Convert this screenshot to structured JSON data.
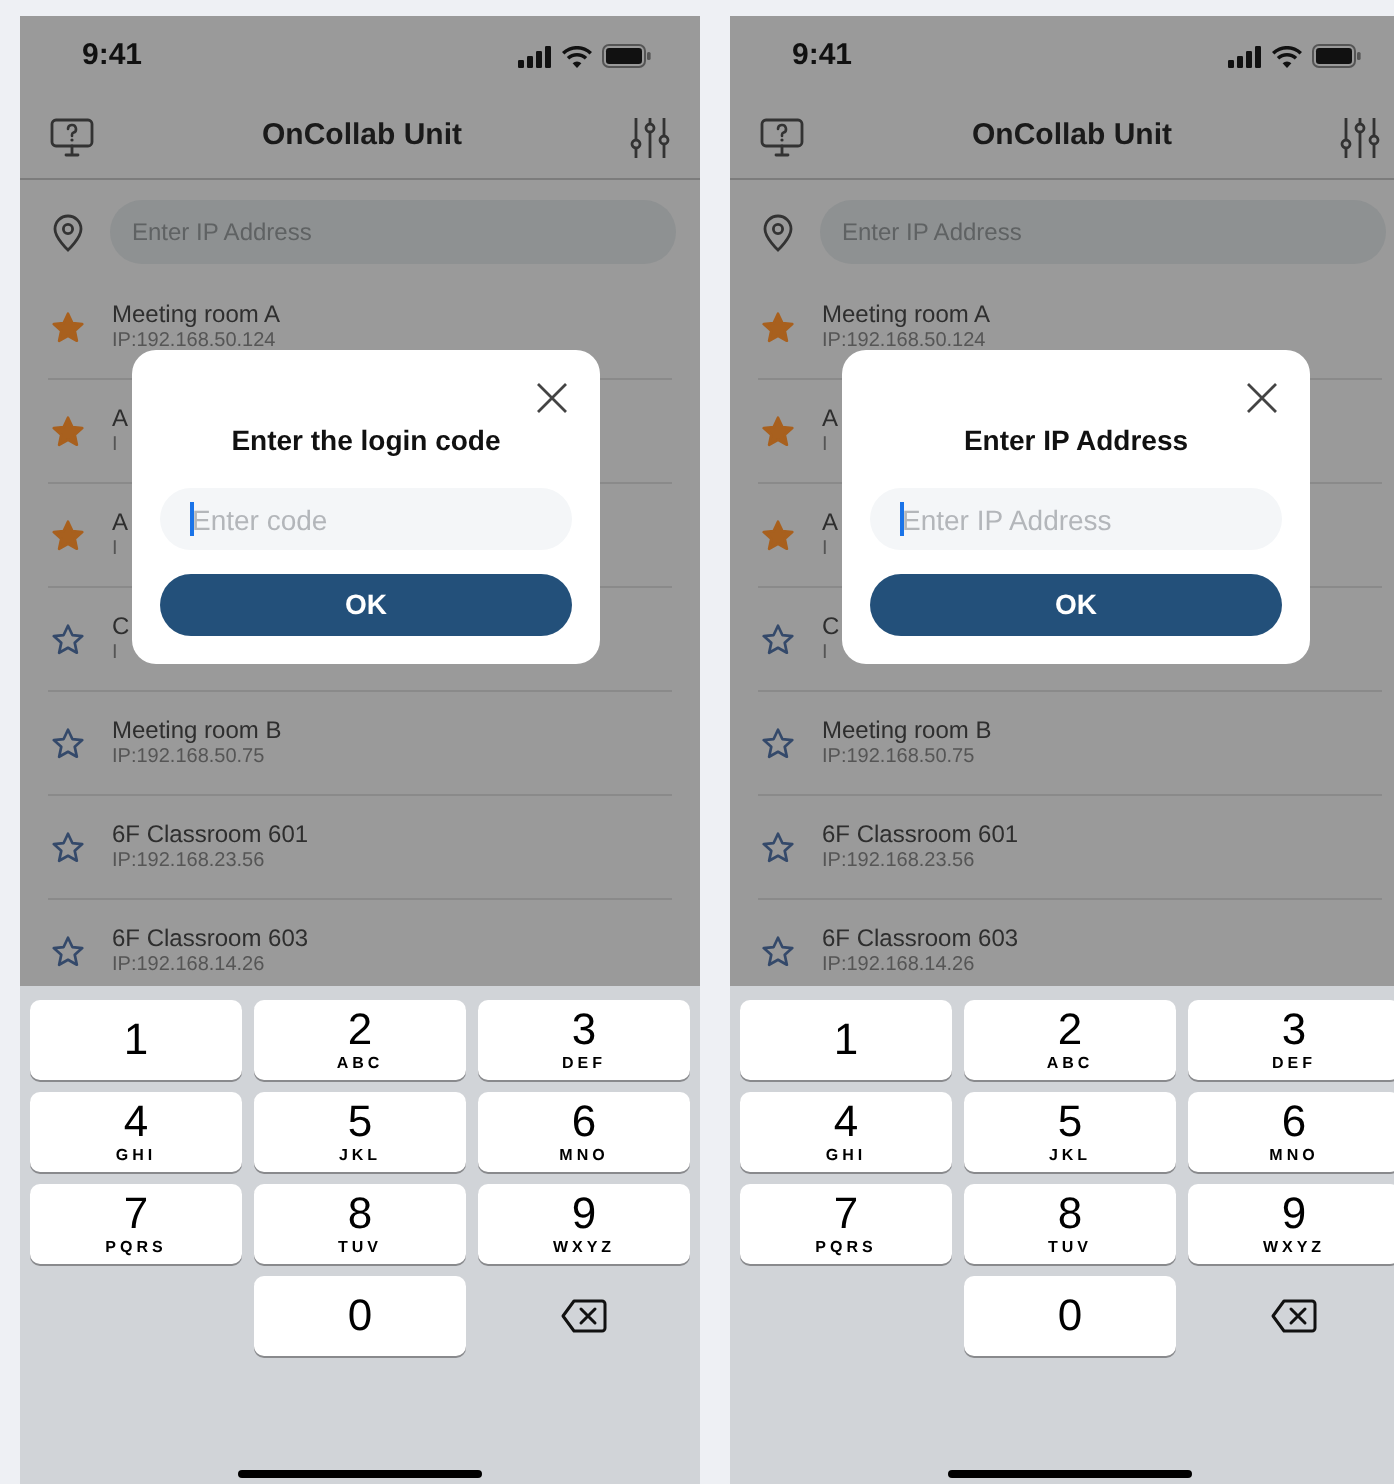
{
  "screens": [
    {
      "status_bar": {
        "time": "9:41"
      },
      "header": {
        "title": "OnCollab Unit"
      },
      "search": {
        "placeholder": "Enter IP Address"
      },
      "rooms": [
        {
          "name": "Meeting room A",
          "ip": "IP:192.168.50.124",
          "favorite": true
        },
        {
          "name": "A",
          "ip": "I",
          "favorite": true
        },
        {
          "name": "A",
          "ip": "I",
          "favorite": true
        },
        {
          "name": "C",
          "ip": "I",
          "favorite": false
        },
        {
          "name": "Meeting room B",
          "ip": "IP:192.168.50.75",
          "favorite": false
        },
        {
          "name": "6F Classroom 601",
          "ip": "IP:192.168.23.56",
          "favorite": false
        },
        {
          "name": "6F Classroom 603",
          "ip": "IP:192.168.14.26",
          "favorite": false
        }
      ],
      "dialog": {
        "title": "Enter the login code",
        "placeholder": "Enter code",
        "button": "OK"
      },
      "keypad": [
        {
          "kind": "digit",
          "digit": "1"
        },
        {
          "kind": "digit",
          "digit": "2",
          "letters": "ABC"
        },
        {
          "kind": "digit",
          "digit": "3",
          "letters": "DEF"
        },
        {
          "kind": "digit",
          "digit": "4",
          "letters": "GHI"
        },
        {
          "kind": "digit",
          "digit": "5",
          "letters": "JKL"
        },
        {
          "kind": "digit",
          "digit": "6",
          "letters": "MNO"
        },
        {
          "kind": "digit",
          "digit": "7",
          "letters": "PQRS"
        },
        {
          "kind": "digit",
          "digit": "8",
          "letters": "TUV"
        },
        {
          "kind": "digit",
          "digit": "9",
          "letters": "WXYZ"
        },
        {
          "kind": "blank"
        },
        {
          "kind": "digit",
          "digit": "0"
        },
        {
          "kind": "backspace"
        }
      ]
    },
    {
      "status_bar": {
        "time": "9:41"
      },
      "header": {
        "title": "OnCollab Unit"
      },
      "search": {
        "placeholder": "Enter IP Address"
      },
      "rooms": [
        {
          "name": "Meeting room A",
          "ip": "IP:192.168.50.124",
          "favorite": true
        },
        {
          "name": "A",
          "ip": "I",
          "favorite": true
        },
        {
          "name": "A",
          "ip": "I",
          "favorite": true
        },
        {
          "name": "C",
          "ip": "I",
          "favorite": false
        },
        {
          "name": "Meeting room B",
          "ip": "IP:192.168.50.75",
          "favorite": false
        },
        {
          "name": "6F Classroom 601",
          "ip": "IP:192.168.23.56",
          "favorite": false
        },
        {
          "name": "6F Classroom 603",
          "ip": "IP:192.168.14.26",
          "favorite": false
        }
      ],
      "dialog": {
        "title": "Enter IP Address",
        "placeholder": "Enter IP Address",
        "button": "OK"
      },
      "keypad": [
        {
          "kind": "digit",
          "digit": "1"
        },
        {
          "kind": "digit",
          "digit": "2",
          "letters": "ABC"
        },
        {
          "kind": "digit",
          "digit": "3",
          "letters": "DEF"
        },
        {
          "kind": "digit",
          "digit": "4",
          "letters": "GHI"
        },
        {
          "kind": "digit",
          "digit": "5",
          "letters": "JKL"
        },
        {
          "kind": "digit",
          "digit": "6",
          "letters": "MNO"
        },
        {
          "kind": "digit",
          "digit": "7",
          "letters": "PQRS"
        },
        {
          "kind": "digit",
          "digit": "8",
          "letters": "TUV"
        },
        {
          "kind": "digit",
          "digit": "9",
          "letters": "WXYZ"
        },
        {
          "kind": "blank"
        },
        {
          "kind": "digit",
          "digit": "0"
        },
        {
          "kind": "backspace"
        }
      ]
    }
  ]
}
